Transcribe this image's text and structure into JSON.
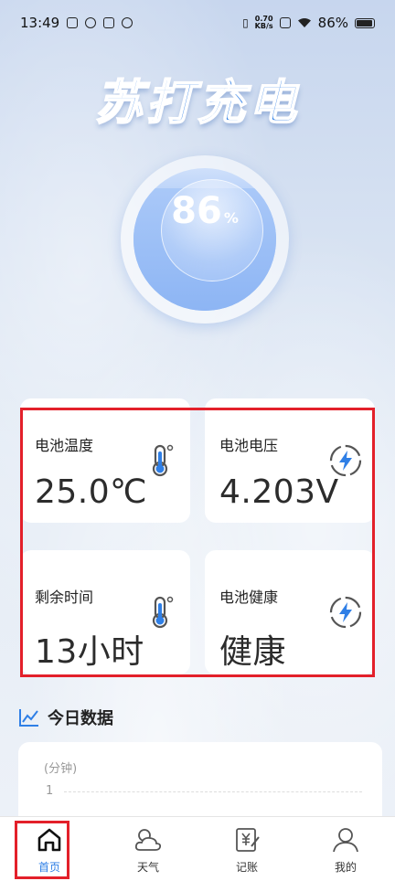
{
  "status_bar": {
    "time": "13:49",
    "net_speed_value": "0.70",
    "net_speed_unit": "KB/s",
    "battery_percent": "86%"
  },
  "app": {
    "title": "苏打充电"
  },
  "gauge": {
    "value": "86",
    "unit": "%",
    "level_percent": 86
  },
  "cards": [
    {
      "label": "电池温度",
      "value": "25.0℃",
      "icon": "thermometer-icon"
    },
    {
      "label": "电池电压",
      "value": "4.203V",
      "icon": "lightning-icon"
    },
    {
      "label": "剩余时间",
      "value": "13小时",
      "icon": "thermometer-icon"
    },
    {
      "label": "电池健康",
      "value": "健康",
      "icon": "lightning-icon"
    }
  ],
  "section": {
    "title": "今日数据"
  },
  "chart_data": {
    "type": "line",
    "ylabel": "(分钟)",
    "y_ticks": [
      "1"
    ],
    "series": []
  },
  "nav": {
    "items": [
      {
        "label": "首页",
        "icon": "home-icon",
        "active": true
      },
      {
        "label": "天气",
        "icon": "weather-icon",
        "active": false
      },
      {
        "label": "记账",
        "icon": "ledger-icon",
        "active": false
      },
      {
        "label": "我的",
        "icon": "user-icon",
        "active": false
      }
    ]
  },
  "colors": {
    "accent": "#2f7fe6",
    "highlight": "#e3202a"
  }
}
